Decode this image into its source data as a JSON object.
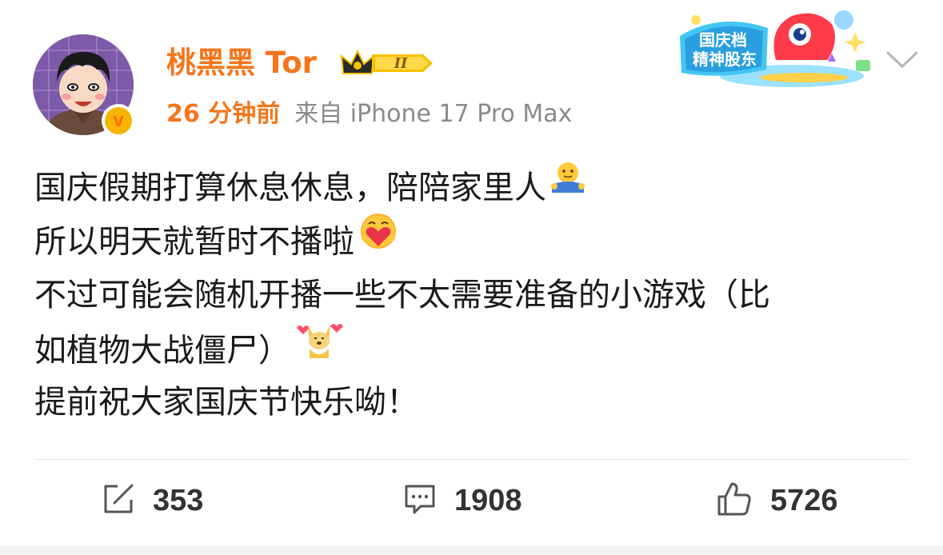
{
  "post": {
    "username": "桃黑黑 Tor",
    "level_badge": "II",
    "time": "26 分钟前",
    "source": "来自 iPhone 17 Pro Max",
    "verified_badge": "v",
    "sticker_text": [
      "国庆档",
      "精神股东"
    ],
    "content_lines": [
      "国庆假期打算休息休息，陪陪家里人",
      "所以明天就暂时不播啦",
      "不过可能会随机开播一些不太需要准备的小游戏（比",
      "如植物大战僵尸）",
      "提前祝大家国庆节快乐呦！"
    ],
    "emojis": [
      "hug-emoji",
      "heart-hug-emoji",
      "shiba-love-emoji"
    ]
  },
  "actions": {
    "repost_count": "353",
    "comment_count": "1908",
    "like_count": "5726"
  },
  "colors": {
    "accent_orange": "#f5761a",
    "meta_gray": "#8a8a8a",
    "divider": "#e6e6e6"
  }
}
